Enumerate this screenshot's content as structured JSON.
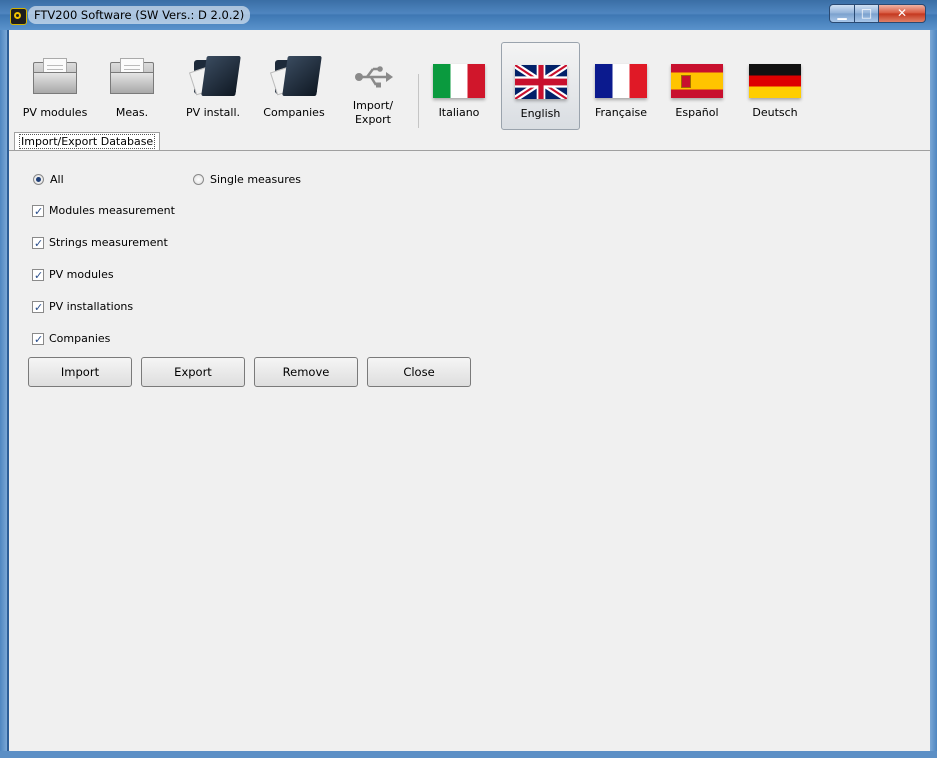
{
  "window": {
    "title": "FTV200 Software (SW Vers.: D 2.0.2)",
    "icons": {
      "app": "app-logo-icon",
      "minimize": "minimize-icon",
      "maximize": "maximize-icon",
      "close": "close-icon"
    }
  },
  "toolbar": {
    "items": [
      {
        "label": "PV modules",
        "icon": "grey-folder-icon"
      },
      {
        "label": "Meas.",
        "icon": "grey-folder-icon"
      },
      {
        "label": "PV install.",
        "icon": "dark-folder-icon"
      },
      {
        "label": "Companies",
        "icon": "dark-folder-icon"
      },
      {
        "label": "Import/",
        "label2": "Export",
        "icon": "usb-icon"
      }
    ],
    "languages": [
      {
        "label": "Italiano",
        "icon": "italy-flag-icon"
      },
      {
        "label": "English",
        "icon": "uk-flag-icon",
        "selected": true
      },
      {
        "label": "Française",
        "icon": "france-flag-icon"
      },
      {
        "label": "Español",
        "icon": "spain-flag-icon"
      },
      {
        "label": "Deutsch",
        "icon": "germany-flag-icon"
      }
    ]
  },
  "tabs": [
    {
      "label": "Import/Export Database",
      "active": true
    }
  ],
  "options": {
    "radios": [
      {
        "label": "All",
        "checked": true
      },
      {
        "label": "Single measures",
        "checked": false
      }
    ],
    "checkboxes": [
      {
        "label": "Modules measurement",
        "checked": true
      },
      {
        "label": "Strings measurement",
        "checked": true
      },
      {
        "label": "PV modules",
        "checked": true
      },
      {
        "label": "PV installations",
        "checked": true
      },
      {
        "label": "Companies",
        "checked": true
      }
    ]
  },
  "buttons": {
    "import": "Import",
    "export": "Export",
    "remove": "Remove",
    "close": "Close"
  },
  "colors": {
    "title_bar": "#4f86c0",
    "background": "#f0f0f0",
    "close_button": "#c3361d"
  }
}
